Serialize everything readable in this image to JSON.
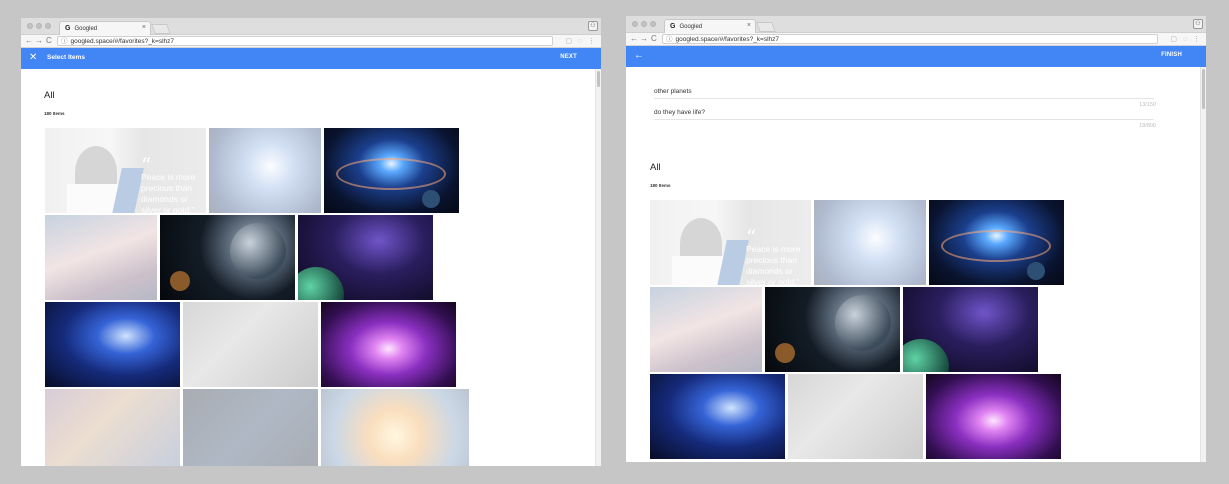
{
  "windows": [
    {
      "tab_title": "Googled",
      "url": "googled.space/#/favorites?_k=slhz7",
      "appbar": {
        "leading_icon": "close-icon",
        "title": "Select Items",
        "action": "NEXT"
      },
      "gallery": {
        "heading": "All",
        "count": "180 Items"
      }
    },
    {
      "tab_title": "Googled",
      "url": "googled.space/#/favorites?_k=slhz7",
      "appbar": {
        "leading_icon": "arrow-back-icon",
        "title": "",
        "action": "FINISH"
      },
      "fields": [
        {
          "value": "other planets",
          "counter": "13/150"
        },
        {
          "value": "do they have life?",
          "counter": "18/800"
        }
      ],
      "gallery": {
        "heading": "All",
        "count": "180 Items"
      }
    }
  ],
  "quote_card": {
    "mark": "“",
    "lines": [
      "Peace is more",
      "precious than",
      "diamonds or",
      "silver or gold.”"
    ]
  },
  "colors": {
    "appbar": "#4285f4",
    "backdrop": "#c6c6c6"
  }
}
